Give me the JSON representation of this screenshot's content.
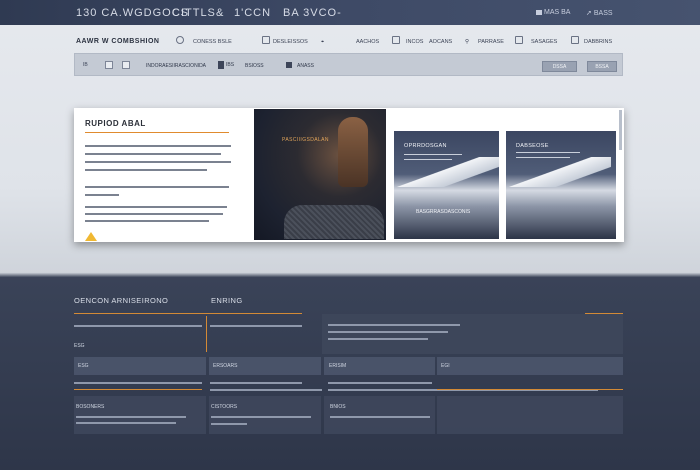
{
  "header": {
    "left": "130 CA.WGDGOCS",
    "mid": "CITTLS",
    "amp": "&",
    "mid2": "1'CCN",
    "right": "BA 3VCO-",
    "search_label": "MAS BA",
    "settings_label": "BASS"
  },
  "toolbar": {
    "brand": "AAWR W COMBSHION",
    "items": [
      "CONESS BSLE",
      "DESLEISSOS",
      "AACHOS",
      "INCOS",
      "AOCANS",
      "PARRASE",
      "SASAGES",
      "DABBRINS"
    ]
  },
  "filter": {
    "input_label": "IB",
    "breadcrumb": "INDORAESIIRASCIONIDA",
    "mid_label": "IBS",
    "mid_text": "BSIOSS",
    "mid_text2": "ANASS",
    "btn1": "DSSA",
    "btn2": "BSSA"
  },
  "article": {
    "title": "RUPIOD ABAL",
    "photo_caption": "PASCIIIGSDALAN",
    "card2_head": "OPRRDOSGAN",
    "card2_caption": "BASGRRASOASCONIS",
    "card3_head": "DABSEOSE"
  },
  "bottom": {
    "title_left": "OENCON ARNISEIRONO",
    "title_right": "ENRING",
    "cells": [
      "ESG",
      "ERSOARS",
      "ERISIM",
      "EGI",
      "BOSONERS",
      "CISTOORS",
      "BNIOS"
    ]
  },
  "colors": {
    "accent": "#e08b2e",
    "warning": "#f0b832",
    "topbar": "#3a4560"
  }
}
